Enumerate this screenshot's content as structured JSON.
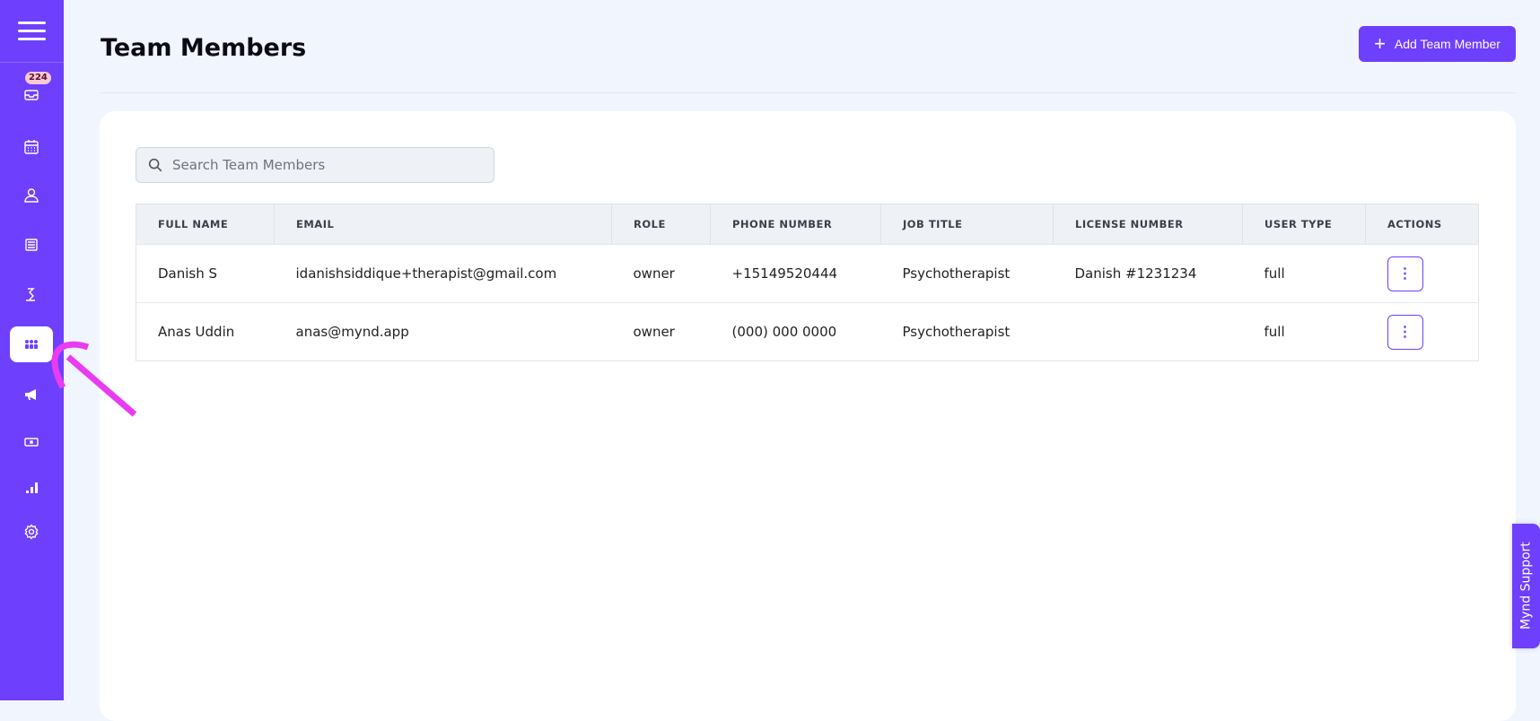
{
  "sidebar": {
    "inbox_badge": "224",
    "items": [
      "inbox",
      "calendar",
      "clients",
      "notes",
      "wellness",
      "team",
      "marketing",
      "billing",
      "reports",
      "settings"
    ],
    "active": "team"
  },
  "header": {
    "title": "Team Members",
    "add_button": "Add Team Member"
  },
  "search": {
    "placeholder": "Search Team Members",
    "value": ""
  },
  "table": {
    "columns": [
      "FULL NAME",
      "EMAIL",
      "ROLE",
      "PHONE NUMBER",
      "JOB TITLE",
      "LICENSE NUMBER",
      "USER TYPE",
      "ACTIONS"
    ],
    "rows": [
      {
        "name": "Danish S",
        "email": "idanishsiddique+therapist@gmail.com",
        "role": "owner",
        "phone": "+15149520444",
        "job": "Psychotherapist",
        "license": "Danish #1231234",
        "type": "full",
        "actions": "⋮"
      },
      {
        "name": "Anas Uddin",
        "email": "anas@mynd.app",
        "role": "owner",
        "phone": "(000) 000 0000",
        "job": "Psychotherapist",
        "license": "",
        "type": "full",
        "actions": "⋮"
      }
    ]
  },
  "support": {
    "label": "Mynd Support"
  },
  "colors": {
    "accent": "#6e3ffc",
    "annotation": "#e93cf0"
  }
}
